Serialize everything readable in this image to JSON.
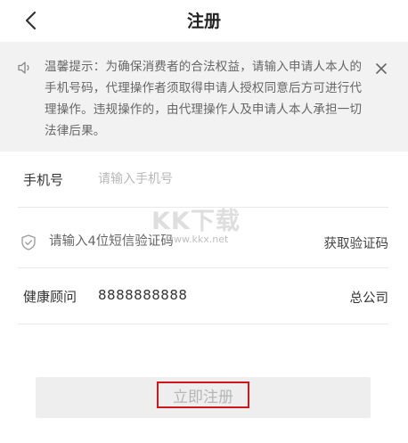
{
  "header": {
    "title": "注册",
    "back_icon": "chevron-left-icon"
  },
  "notice": {
    "icon": "speaker-icon",
    "text": "温馨提示：为确保消费者的合法权益，请输入申请人本人的手机号码，代理操作者须取得申请人授权同意后方可进行代理操作。违规操作的，由代理操作人及申请人本人承担一切法律后果。",
    "close_icon": "close-icon"
  },
  "form": {
    "phone": {
      "label": "手机号",
      "placeholder": "请输入手机号",
      "value": ""
    },
    "code": {
      "icon": "shield-check-icon",
      "placeholder": "请输入4位短信验证码",
      "value": "",
      "get_code_label": "获取验证码"
    },
    "consultant": {
      "label": "健康顾问",
      "value": "8888888888",
      "company_label": "总公司"
    }
  },
  "watermark": {
    "main": "KK下载",
    "sub": "www.kkx.net"
  },
  "submit": {
    "label": "立即注册"
  },
  "colors": {
    "highlight_border": "#d0181b",
    "notice_bg": "#f2f2f2",
    "button_bg": "#eeeeee"
  }
}
